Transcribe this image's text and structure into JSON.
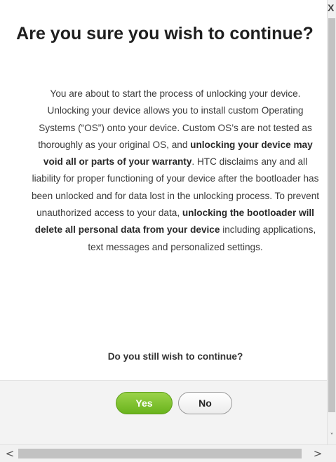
{
  "dialog": {
    "title": "Are you sure you wish to continue?",
    "body": [
      {
        "text": "You are about to start the process of unlocking your device. Unlocking your device allows you to install custom Operating Systems (“OS”) onto your device. Custom OS’s are not tested as thoroughly as your original OS, and ",
        "bold": false
      },
      {
        "text": "unlocking your device may void all or parts of your warranty",
        "bold": true
      },
      {
        "text": ". HTC disclaims any and all liability for proper functioning of your device after the bootloader has been unlocked and for data lost in the unlocking process. To prevent unauthorized access to your data, ",
        "bold": false
      },
      {
        "text": "unlocking the bootloader will delete all personal data from your device",
        "bold": true
      },
      {
        "text": " including applications, text messages and personalized settings.",
        "bold": false
      }
    ],
    "question": "Do you still wish to continue?",
    "yes_label": "Yes",
    "no_label": "No",
    "close_label": "X"
  },
  "scrollbars": {
    "left_arrow": "<",
    "right_arrow": ">",
    "down_arrow": "˅"
  },
  "colors": {
    "yes_button": "#7cc236",
    "button_bar": "#f3f3f3",
    "title_text": "#1f1f1f"
  }
}
